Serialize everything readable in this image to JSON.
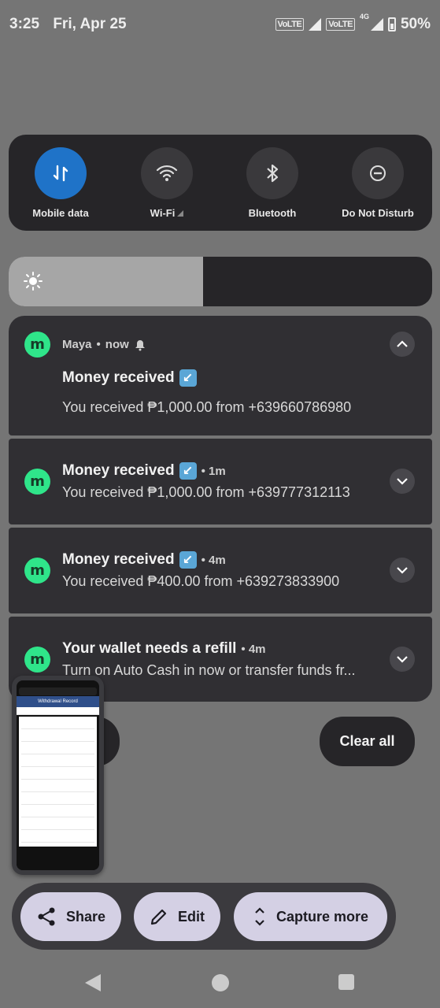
{
  "status_bar": {
    "time": "3:25",
    "date": "Fri, Apr 25",
    "volte1": "VoLTE",
    "volte2": "VoLTE",
    "network_type": "4G",
    "battery": "50%"
  },
  "quick_settings": [
    {
      "label": "Mobile data",
      "icon": "mobile-data-icon",
      "active": true
    },
    {
      "label": "Wi-Fi",
      "icon": "wifi-icon",
      "active": false
    },
    {
      "label": "Bluetooth",
      "icon": "bluetooth-icon",
      "active": false
    },
    {
      "label": "Do Not Disturb",
      "icon": "do-not-disturb-icon",
      "active": false
    }
  ],
  "brightness": {
    "level": 0.46
  },
  "notifications": [
    {
      "app": "Maya",
      "header_time": "now",
      "title": "Money received",
      "body": "You received ₱1,000.00 from +639660786980"
    },
    {
      "title": "Money received",
      "time": "1m",
      "body": "You received ₱1,000.00 from +639777312113"
    },
    {
      "title": "Money received",
      "time": "4m",
      "body": "You received ₱400.00 from +639273833900"
    },
    {
      "title": "Your wallet needs a refill",
      "time": "4m",
      "body": "Turn on Auto Cash in now or transfer funds fr..."
    }
  ],
  "clear_all_label": "Clear all",
  "thumbnail": {
    "header": "Withdrawal Record"
  },
  "screenshot_actions": {
    "share": "Share",
    "edit": "Edit",
    "capture_more": "Capture more"
  },
  "colors": {
    "accent_blue": "#1f73c8",
    "maya_green": "#2fe58a",
    "panel": "#262528",
    "card": "#302f33"
  }
}
